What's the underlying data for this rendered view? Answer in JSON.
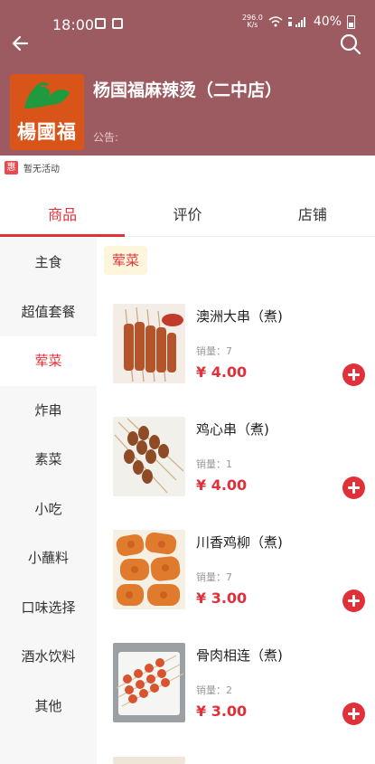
{
  "status_bar": {
    "time": "18:00",
    "net_speed_value": "296.0",
    "net_speed_unit": "K/s",
    "battery": "40%"
  },
  "shop": {
    "name": "杨国福麻辣烫（二中店）",
    "logo_text": "楊國福",
    "notice": "公告:"
  },
  "promo": {
    "badge": "惠",
    "text": "暂无活动"
  },
  "tabs": [
    {
      "label": "商品"
    },
    {
      "label": "评价"
    },
    {
      "label": "店铺"
    }
  ],
  "categories": [
    {
      "label": "主食"
    },
    {
      "label": "超值套餐"
    },
    {
      "label": "荤菜"
    },
    {
      "label": "炸串"
    },
    {
      "label": "素菜"
    },
    {
      "label": "小吃"
    },
    {
      "label": "小蘸料"
    },
    {
      "label": "口味选择"
    },
    {
      "label": "酒水饮料"
    },
    {
      "label": "其他"
    }
  ],
  "section": {
    "title": "荤菜"
  },
  "products": [
    {
      "name": "澳洲大串（煮)",
      "sales": "销量：7",
      "price": "¥ 4.00"
    },
    {
      "name": "鸡心串（煮)",
      "sales": "销量：1",
      "price": "¥ 4.00"
    },
    {
      "name": "川香鸡柳（煮)",
      "sales": "销量：7",
      "price": "¥ 3.00"
    },
    {
      "name": "骨肉相连（煮)",
      "sales": "销量：2",
      "price": "¥ 3.00"
    }
  ],
  "colors": {
    "header_bg": "#9c5a61",
    "accent": "#e0303a",
    "logo_bg": "#d95418",
    "sidebar_bg": "#f7f7f7",
    "chip_bg": "#fdf5dc"
  },
  "icons": {
    "back": "arrow-left-icon",
    "search": "search-icon",
    "add": "plus-circle-icon"
  }
}
